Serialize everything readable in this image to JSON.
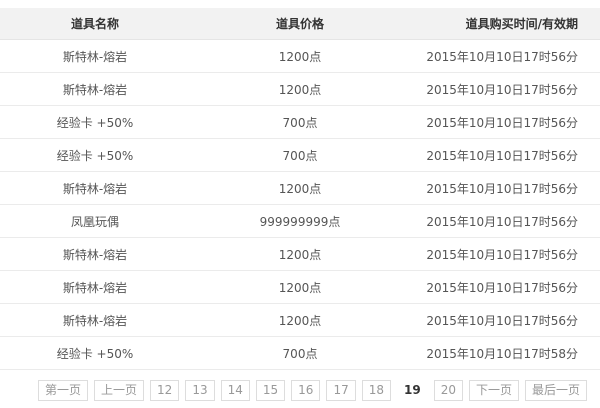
{
  "table": {
    "headers": [
      "道具名称",
      "道具价格",
      "道具购买时间/有效期"
    ],
    "rows": [
      [
        "斯特林-熔岩",
        "1200点",
        "2015年10月10日17时56分"
      ],
      [
        "斯特林-熔岩",
        "1200点",
        "2015年10月10日17时56分"
      ],
      [
        "经验卡 +50%",
        "700点",
        "2015年10月10日17时56分"
      ],
      [
        "经验卡 +50%",
        "700点",
        "2015年10月10日17时56分"
      ],
      [
        "斯特林-熔岩",
        "1200点",
        "2015年10月10日17时56分"
      ],
      [
        "凤凰玩偶",
        "999999999点",
        "2015年10月10日17时56分"
      ],
      [
        "斯特林-熔岩",
        "1200点",
        "2015年10月10日17时56分"
      ],
      [
        "斯特林-熔岩",
        "1200点",
        "2015年10月10日17时56分"
      ],
      [
        "斯特林-熔岩",
        "1200点",
        "2015年10月10日17时56分"
      ],
      [
        "经验卡 +50%",
        "700点",
        "2015年10月10日17时58分"
      ]
    ]
  },
  "pager": {
    "first": "第一页",
    "prev": "上一页",
    "pages": [
      "12",
      "13",
      "14",
      "15",
      "16",
      "17",
      "18",
      "19",
      "20"
    ],
    "current": "19",
    "next": "下一页",
    "last": "最后一页"
  }
}
